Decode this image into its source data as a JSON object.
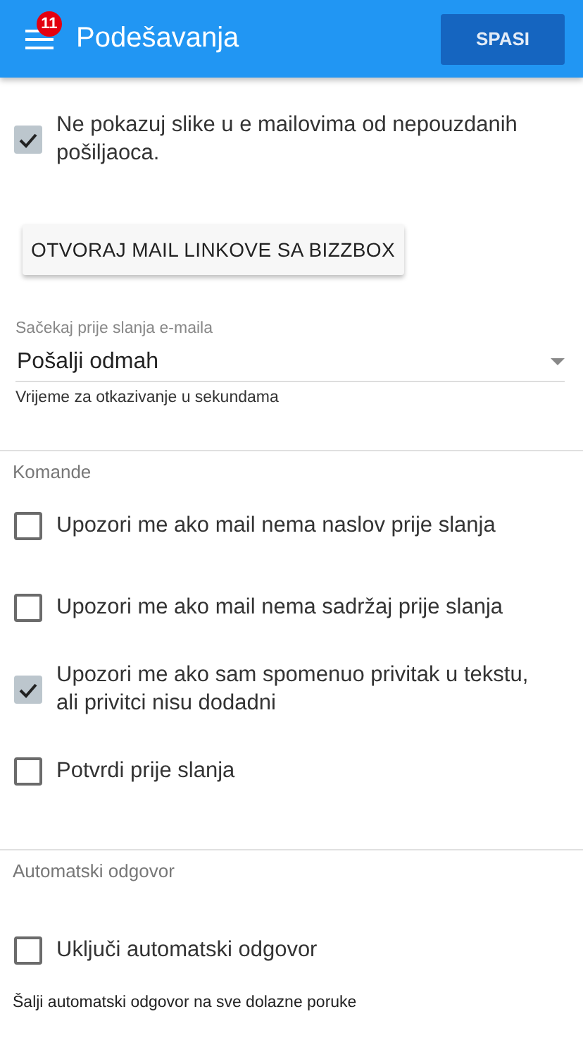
{
  "app_bar": {
    "menu_badge": "11",
    "title": "Podešavanja",
    "save_button": "SPASI"
  },
  "images_option": {
    "label": "Ne pokazuj slike u e mailovima od nepouzdanih pošiljaoca.",
    "checked": true
  },
  "open_links_button": "OTVORAJ MAIL LINKOVE SA BIZZBOX",
  "send_delay": {
    "label": "Sačekaj prije slanja e-maila",
    "value": "Pošalji odmah",
    "helper": "Vrijeme za otkazivanje u sekundama"
  },
  "sections": [
    {
      "title": "Komande",
      "options": [
        {
          "label": "Upozori me ako mail nema naslov prije slanja",
          "checked": false
        },
        {
          "label": "Upozori me ako mail nema sadržaj prije slanja",
          "checked": false
        },
        {
          "label": "Upozori me ako sam spomenuo privitak u tekstu, ali privitci nisu dodadni",
          "checked": true
        },
        {
          "label": "Potvrdi prije slanja",
          "checked": false
        }
      ]
    },
    {
      "title": "Automatski odgovor",
      "options": [
        {
          "label": "Uključi automatski odgovor",
          "checked": false
        }
      ],
      "helper": "Šalji automatski odgovor na sve dolazne poruke"
    }
  ]
}
